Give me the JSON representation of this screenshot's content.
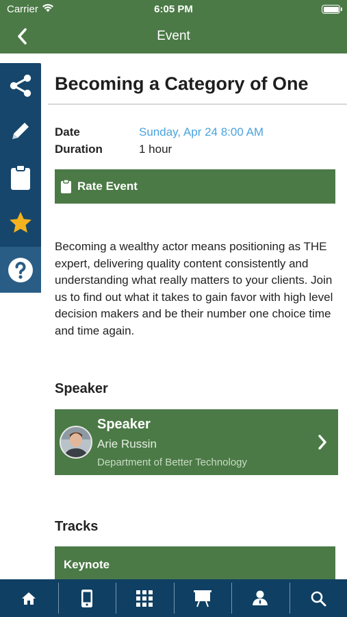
{
  "status_bar": {
    "carrier": "Carrier",
    "time": "6:05 PM"
  },
  "nav": {
    "title": "Event",
    "back_icon": "chevron-left-icon"
  },
  "side_rail": {
    "items": [
      {
        "name": "share",
        "icon": "share-icon"
      },
      {
        "name": "note",
        "icon": "pencil-icon"
      },
      {
        "name": "survey",
        "icon": "clipboard-icon"
      },
      {
        "name": "favorite",
        "icon": "star-icon",
        "color": "#f5b21e"
      },
      {
        "name": "help",
        "icon": "question-icon"
      }
    ]
  },
  "event": {
    "title": "Becoming a Category of One",
    "date_label": "Date",
    "date_value": "Sunday, Apr 24 8:00 AM",
    "duration_label": "Duration",
    "duration_value": "1 hour",
    "rate_label": "Rate Event",
    "description": "Becoming a wealthy actor means positioning as THE expert, delivering quality content consistently and understanding what really matters to your clients. Join us to find out what it takes to gain favor with high level decision makers and be their number one choice time and time again."
  },
  "speaker_section": {
    "heading": "Speaker",
    "card": {
      "heading": "Speaker",
      "name": "Arie Russin",
      "department": "Department of Better Technology"
    }
  },
  "tracks_section": {
    "heading": "Tracks",
    "items": [
      "Keynote"
    ]
  },
  "tab_bar": {
    "tabs": [
      {
        "icon": "home-icon"
      },
      {
        "icon": "mobile-icon"
      },
      {
        "icon": "grid-icon"
      },
      {
        "icon": "presentation-icon"
      },
      {
        "icon": "person-icon"
      },
      {
        "icon": "search-icon"
      }
    ]
  },
  "colors": {
    "brand_green": "#4b7a46",
    "navy": "#0f3f63",
    "link_blue": "#4aa3de",
    "star_gold": "#f5b21e"
  }
}
